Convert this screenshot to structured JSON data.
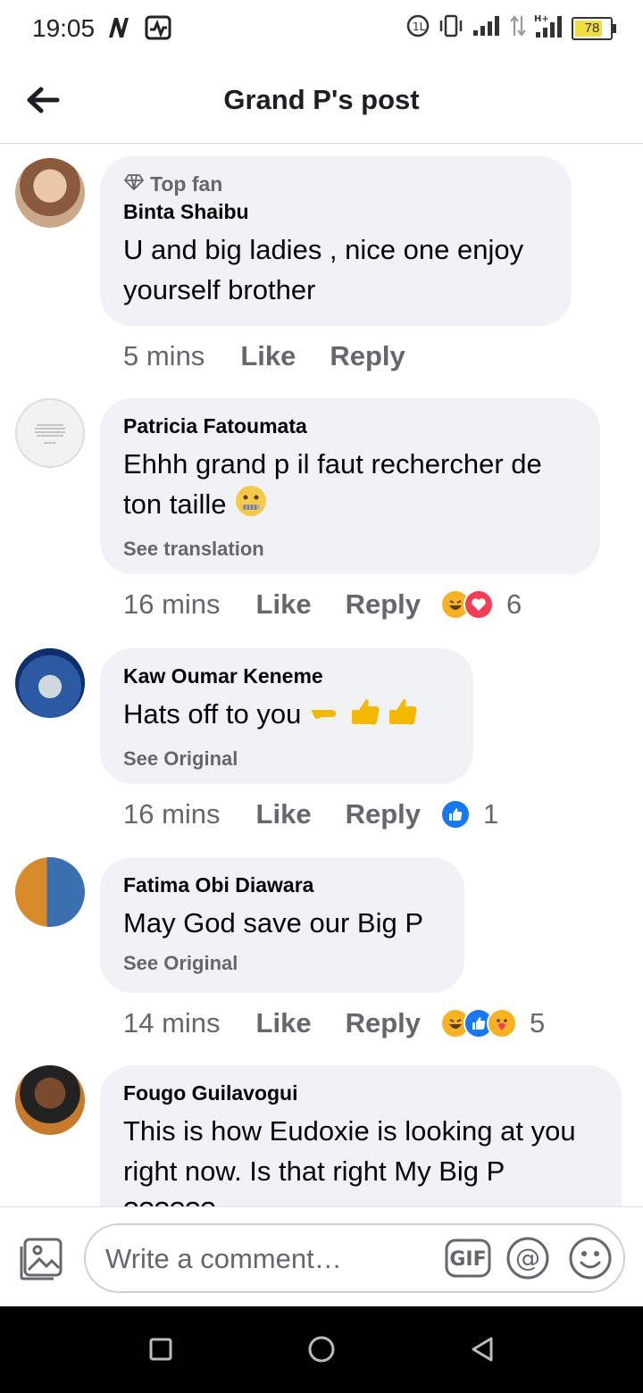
{
  "status_bar": {
    "time": "19:05",
    "battery": "78",
    "icons": [
      "n-icon",
      "activity-icon",
      "alarm-icon",
      "vibrate-icon",
      "signal-icon",
      "data-arrows-icon",
      "hplus-signal-icon",
      "battery-icon"
    ]
  },
  "header": {
    "title": "Grand P's post",
    "back_icon": "arrow-left-icon"
  },
  "comments": [
    {
      "badge": "Top fan",
      "author": "Binta Shaibu",
      "text": "U and big ladies , nice one enjoy yourself brother",
      "time": "5 mins",
      "like": "Like",
      "reply": "Reply"
    },
    {
      "author": "Patricia Fatoumata",
      "text": "Ehhh grand p il faut rechercher de ton taille",
      "emoji": "zipper-mouth-face",
      "subtle": "See translation",
      "time": "16 mins",
      "like": "Like",
      "reply": "Reply",
      "reactions": [
        "haha",
        "love"
      ],
      "reaction_count": "6"
    },
    {
      "author": "Kaw Oumar Keneme",
      "text": "Hats off to you",
      "emoji": "pointing-and-thumbs-up",
      "subtle": "See Original",
      "time": "16 mins",
      "like": "Like",
      "reply": "Reply",
      "reactions": [
        "like"
      ],
      "reaction_count": "1"
    },
    {
      "author": "Fatima Obi Diawara",
      "text": "May God save our Big P",
      "subtle": "See Original",
      "time": "14 mins",
      "like": "Like",
      "reply": "Reply",
      "reactions": [
        "haha",
        "like",
        "care"
      ],
      "reaction_count": "5"
    },
    {
      "author": "Fougo Guilavogui",
      "text": "This is how Eudoxie is looking at you right now. Is that right My Big P ??????"
    }
  ],
  "composer": {
    "placeholder": "Write a comment…",
    "gif_label": "GIF"
  },
  "colors": {
    "bubble": "#f0f2f5",
    "secondary_text": "#65676b",
    "like_blue": "#1877f2",
    "love_red": "#f33e58",
    "haha_yellow": "#f7b125"
  }
}
